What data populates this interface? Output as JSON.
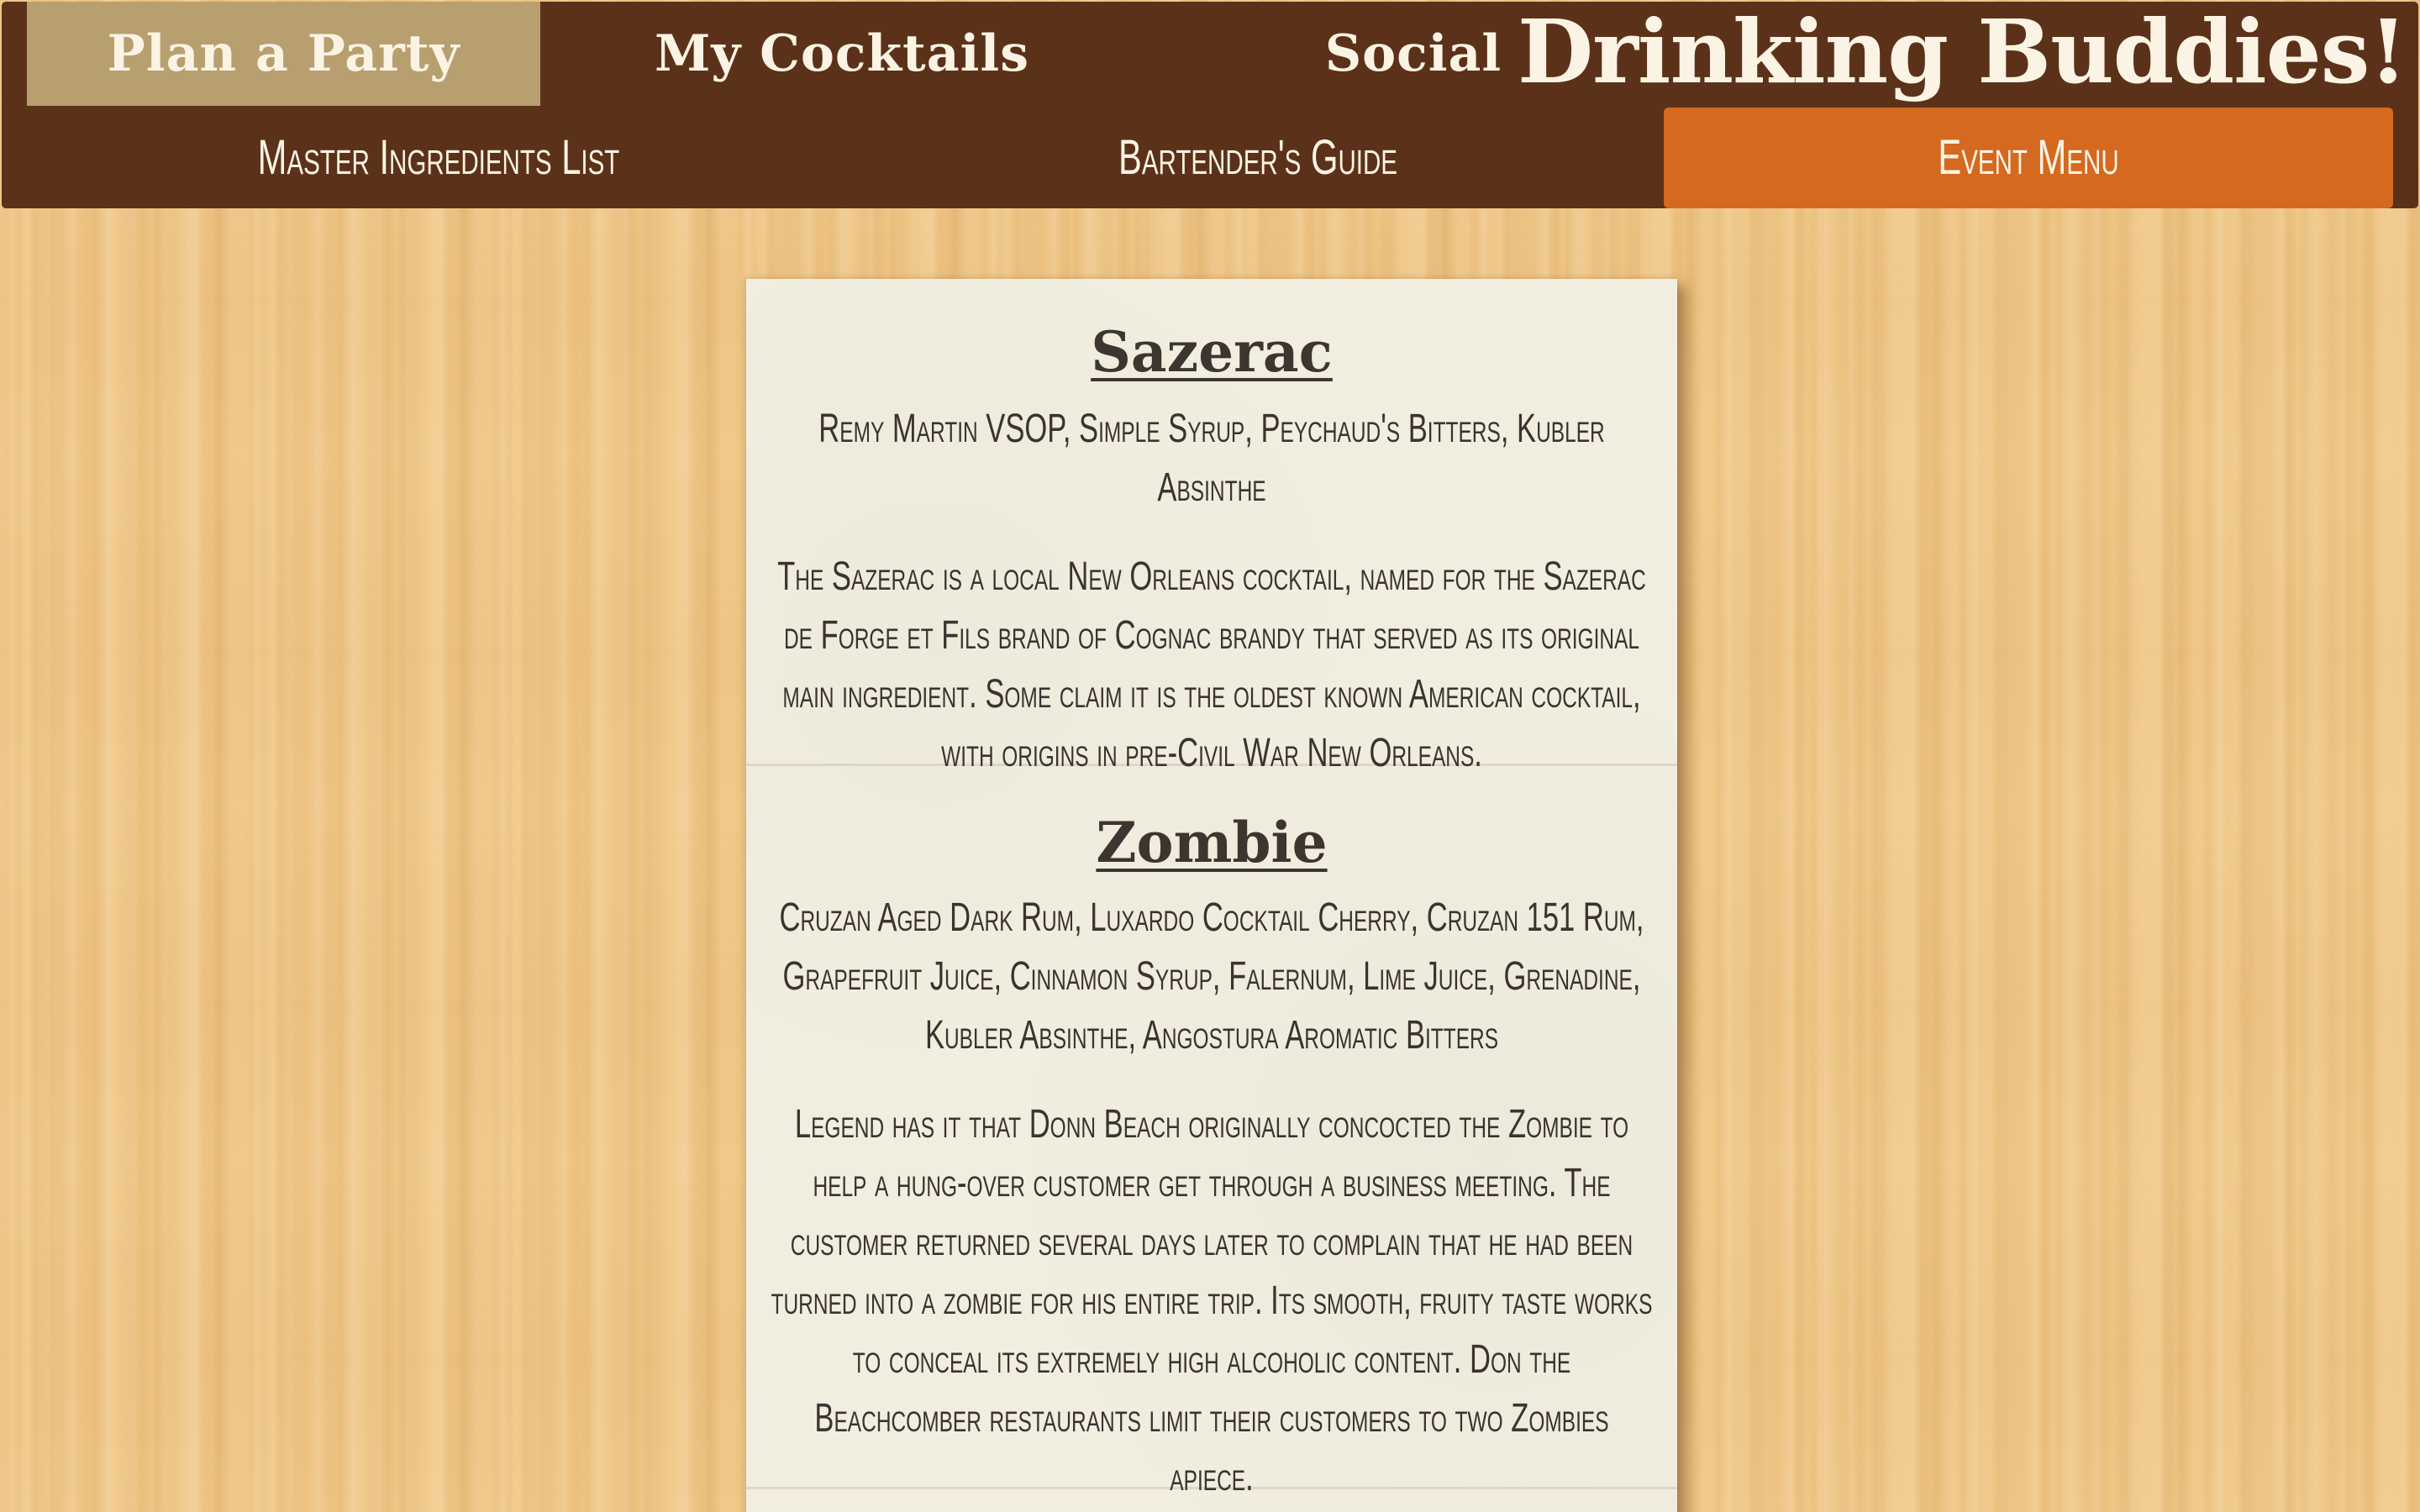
{
  "nav": {
    "top": [
      {
        "label": "Plan a Party",
        "active": true
      },
      {
        "label": "My Cocktails",
        "active": false
      },
      {
        "label": "Social",
        "active": false
      }
    ],
    "brand": "Drinking Buddies!",
    "sub": [
      {
        "label": "Master Ingredients List",
        "active": false
      },
      {
        "label": "Bartender's Guide",
        "active": false
      },
      {
        "label": "Event Menu",
        "active": true
      }
    ]
  },
  "menu": {
    "drinks": [
      {
        "name": "Sazerac",
        "ingredients": "Remy Martin VSOP, Simple Syrup, Peychaud's Bitters, Kubler Absinthe",
        "description": "The Sazerac is a local New Orleans cocktail, named for the Sazerac de Forge et Fils brand of Cognac brandy that served as its original main ingredient. Some claim it is the oldest known American cocktail, with origins in pre-Civil War New Orleans."
      },
      {
        "name": "Zombie",
        "ingredients": "Cruzan Aged Dark Rum, Luxardo Cocktail Cherry, Cruzan 151 Rum, Grapefruit Juice, Cinnamon Syrup, Falernum, Lime Juice, Grenadine, Kubler Absinthe, Angostura Aromatic Bitters",
        "description": "Legend has it that Donn Beach originally concocted the Zombie to help a hung-over customer get through a business meeting. The customer returned several days later to complain that he had been turned into a zombie for his entire trip. Its smooth, fruity taste works to conceal its extremely high alcoholic content. Don the Beachcomber restaurants limit their customers to two Zombies apiece."
      }
    ]
  },
  "colors": {
    "navbar": "#5c311a",
    "nav_active_top": "#b89f6f",
    "nav_active_sub": "#d4691f",
    "card": "#f1eedf",
    "wood": "#f1c98a"
  }
}
